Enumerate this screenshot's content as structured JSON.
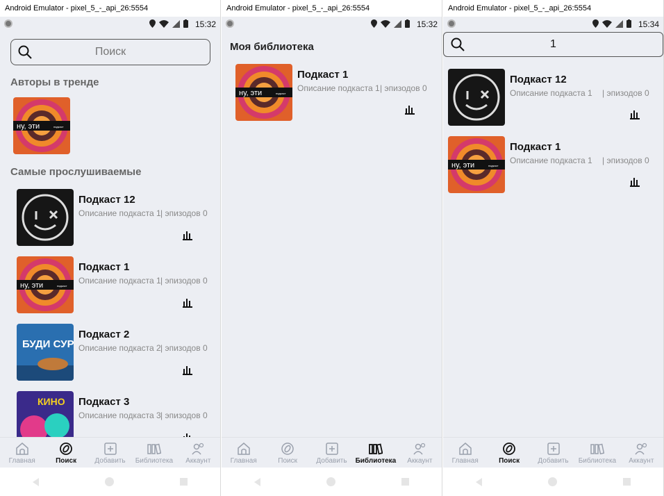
{
  "windows": [
    {
      "title": "Android Emulator - pixel_5_-_api_26:5554",
      "status_time": "15:32",
      "search": {
        "placeholder": "Поиск",
        "value": ""
      },
      "trending_heading": "Авторы в тренде",
      "popular_heading": "Самые прослушиваемые",
      "items": [
        {
          "title": "Подкаст 12",
          "description": "Описание подкаста 1",
          "episodes": "| эпизодов 0",
          "cover": "smiley-cover"
        },
        {
          "title": "Подкаст 1",
          "description": "Описание подкаста 1",
          "episodes": "| эпизодов 0",
          "cover": "swirl-cover"
        },
        {
          "title": "Подкаст 2",
          "description": "Описание подкаста 2",
          "episodes": "| эпизодов 0",
          "cover": "budi-surka-cover"
        },
        {
          "title": "Подкаст 3",
          "description": "Описание подкаста 3",
          "episodes": "| эпизодов 0",
          "cover": "kino-cover"
        }
      ],
      "active_tab": "search"
    },
    {
      "title": "Android Emulator - pixel_5_-_api_26:5554",
      "status_time": "15:32",
      "library_heading": "Моя библиотека",
      "items": [
        {
          "title": "Подкаст 1",
          "description": "Описание подкаста 1",
          "episodes": "| эпизодов 0",
          "cover": "swirl-cover"
        }
      ],
      "active_tab": "library"
    },
    {
      "title": "Android Emulator - pixel_5_-_api_26:5554",
      "status_time": "15:34",
      "search": {
        "placeholder": "",
        "value": "1"
      },
      "items": [
        {
          "title": "Подкаст 12",
          "description": "Описание подкаста 1",
          "episodes": "| эпизодов 0",
          "cover": "smiley-cover"
        },
        {
          "title": "Подкаст 1",
          "description": "Описание подкаста 1",
          "episodes": "| эпизодов 0",
          "cover": "swirl-cover"
        }
      ],
      "active_tab": "search"
    }
  ],
  "cover_text": {
    "swirl": "ну, эти",
    "swirl_small": "подкаст",
    "budi": "БУДИ СУРКА",
    "kino": "КИНО"
  },
  "nav": {
    "home": "Главная",
    "search": "Поиск",
    "add": "Добавить",
    "library": "Библиотека",
    "account": "Аккаунт"
  },
  "colors": {
    "screen_bg": "#eceef3",
    "text_primary": "#111111",
    "text_secondary": "#888888",
    "nav_inactive": "#9aa0ac"
  }
}
